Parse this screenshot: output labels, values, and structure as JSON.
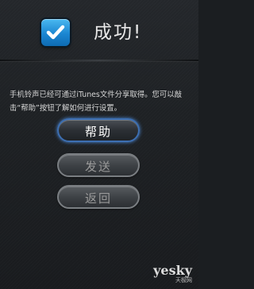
{
  "dialog": {
    "title": "成功!",
    "icon": "checkbox-checked-icon",
    "message": "手机铃声已经可通过iTunes文件分享取得。您可以敲击“帮助”按钮了解如何进行设置。"
  },
  "buttons": {
    "help_label": "帮助",
    "send_label": "发送",
    "back_label": "返回"
  },
  "watermark": {
    "brand": "yesky",
    "brand_cn": "天极网"
  },
  "colors": {
    "accent": "#1b86d1",
    "help_glow": "#4f8fe0",
    "background": "#1e2124"
  }
}
